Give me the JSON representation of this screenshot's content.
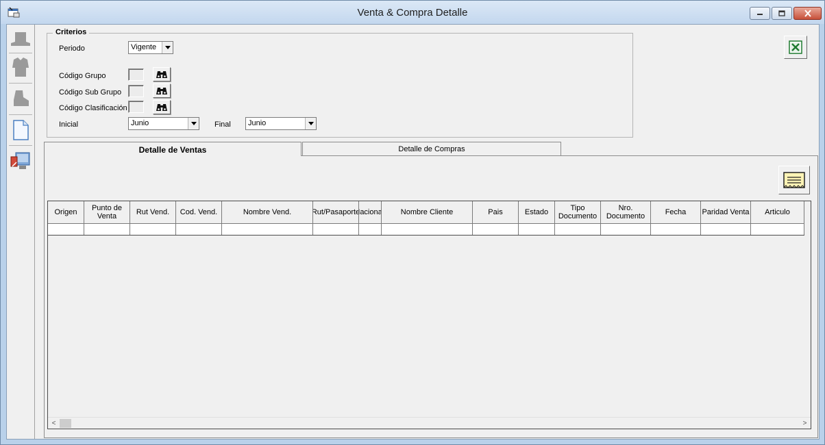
{
  "window": {
    "title": "Venta & Compra Detalle",
    "min_symbol": "▭",
    "max_symbol": "▢",
    "close_symbol": "✕"
  },
  "criteria": {
    "legend": "Criterios",
    "periodo_label": "Periodo",
    "periodo_value": "Vigente",
    "codigo_grupo_label": "Código Grupo",
    "codigo_subgrupo_label": "Código Sub Grupo",
    "codigo_clasificacion_label": "Código Clasificación",
    "inicial_label": "Inicial",
    "inicial_value": "Junio",
    "final_label": "Final",
    "final_value": "Junio"
  },
  "tabs": [
    {
      "label": "Detalle de Ventas",
      "active": true
    },
    {
      "label": "Detalle de Compras",
      "active": false
    }
  ],
  "grid": {
    "columns": [
      "Origen",
      "Punto de\nVenta",
      "Rut Vend.",
      "Cod. Vend.",
      "Nombre Vend.",
      "Rut/Pasaporte",
      "Nacionali",
      "Nombre Cliente",
      "Pais",
      "Estado",
      "Tipo\nDocumento",
      "Nro.\nDocumento",
      "Fecha",
      "Paridad Venta",
      "Articulo"
    ],
    "scroll_left": "<",
    "scroll_right": ">"
  },
  "icons": {
    "app": "app-window-icon",
    "excel": "excel-icon",
    "print": "print-report-icon",
    "binoculars": "binoculars-icon"
  },
  "colors": {
    "titlebar": "#c3d7ee",
    "client_bg": "#f0f0f0",
    "close_button": "#c7503a",
    "excel_green": "#1d7a2f"
  }
}
